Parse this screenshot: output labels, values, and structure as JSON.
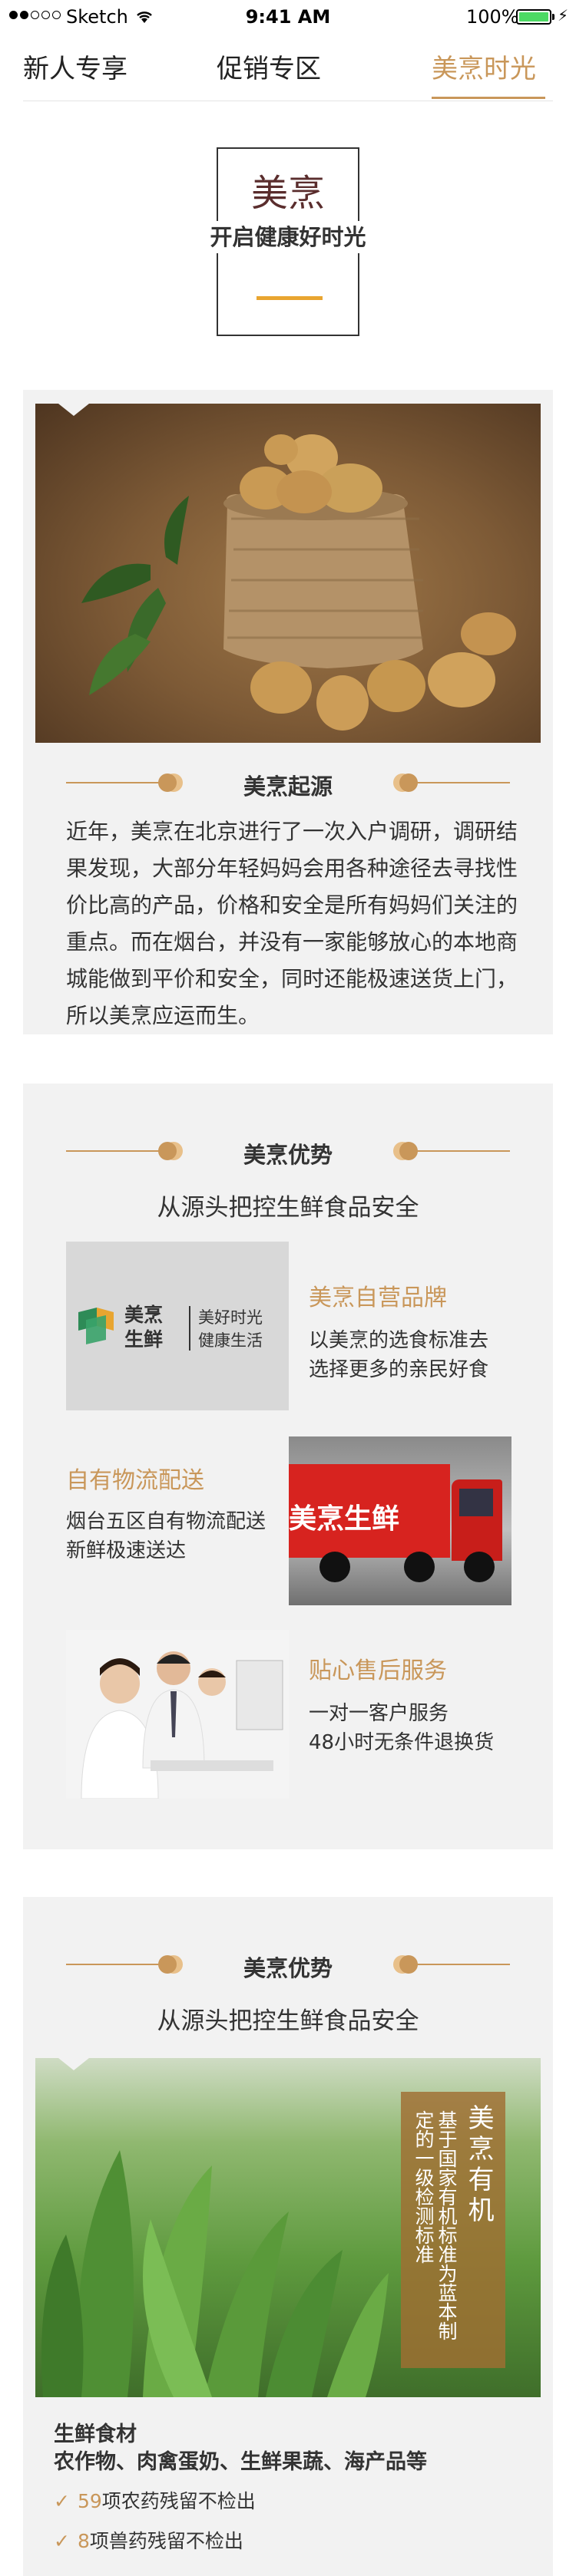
{
  "status_bar": {
    "carrier": "Sketch",
    "time": "9:41 AM",
    "battery": "100%"
  },
  "tabs": [
    "新人专享",
    "促销专区",
    "美烹时光"
  ],
  "hero": {
    "brand": "美烹",
    "subtitle": "开启健康好时光"
  },
  "origin": {
    "title": "美烹起源",
    "text": "近年，美烹在北京进行了一次入户调研，调研结果发现，大部分年轻妈妈会用各种途径去寻找性价比高的产品，价格和安全是所有妈妈们关注的重点。而在烟台，并没有一家能够放心的本地商城能做到平价和安全，同时还能极速送货上门，所以美烹应运而生。"
  },
  "advantage": {
    "title": "美烹优势",
    "subtitle": "从源头把控生鲜食品安全",
    "features": [
      {
        "title": "美烹自营品牌",
        "desc": [
          "以美烹的选食标准去",
          "选择更多的亲民好食"
        ]
      },
      {
        "title": "自有物流配送",
        "desc": [
          "烟台五区自有物流配送",
          "新鲜极速送达"
        ]
      },
      {
        "title": "贴心售后服务",
        "desc": [
          "一对一客户服务",
          "48小时无条件退换货"
        ]
      }
    ],
    "brand_card": {
      "name_top": "美烹",
      "name_bottom": "生鲜",
      "slogan_top": "美好时光",
      "slogan_bottom": "健康生活"
    },
    "truck_text": "美烹生鲜"
  },
  "advantage2": {
    "title": "美烹优势",
    "subtitle": "从源头把控生鲜食品安全",
    "organic_title": "美烹有机",
    "organic_desc": "基于国家有机标准为蓝本制定的一级检测标准",
    "food_title": "生鲜食材",
    "food_cats": "农作物、肉禽蛋奶、生鲜果蔬、海产品等",
    "checks": [
      {
        "num": "59",
        "text": "项农药残留不检出"
      },
      {
        "num": "8",
        "text": "项兽药残留不检出"
      }
    ]
  },
  "colors": {
    "accent": "#c9975a",
    "section_bg": "#f2f2f2",
    "gold_line": "#e9a530"
  }
}
